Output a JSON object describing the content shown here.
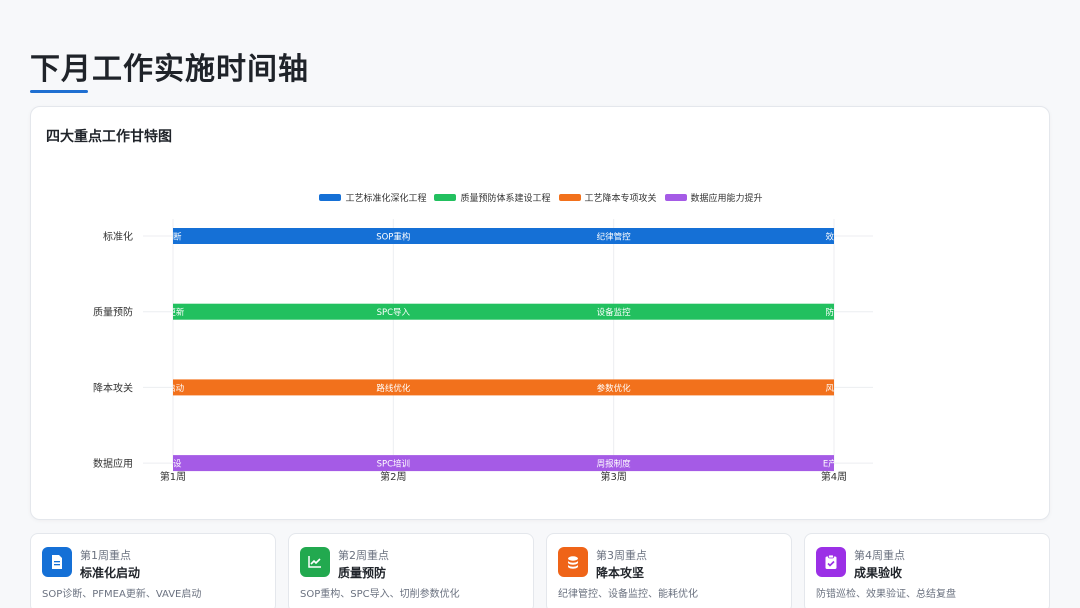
{
  "page": {
    "title": "下月工作实施时间轴"
  },
  "chart_card": {
    "title": "四大重点工作甘特图"
  },
  "colors": {
    "accent": "#1f6fd1",
    "blue": "#1570d6",
    "green": "#22c05f",
    "orange": "#f2711c",
    "purple": "#a55be6"
  },
  "chart_data": {
    "type": "bar",
    "orientation": "horizontal",
    "subtype": "gantt",
    "categories": [
      "标准化",
      "质量预防",
      "降本攻关",
      "数据应用"
    ],
    "x_ticks": [
      "第1周",
      "第2周",
      "第3周",
      "第4周"
    ],
    "xlim": [
      1,
      4
    ],
    "legend_position": "top",
    "grid": true,
    "series": [
      {
        "name": "工艺标准化深化工程",
        "color": "#1570d6",
        "category": "标准化",
        "start": 1,
        "end": 4,
        "labels": [
          {
            "x": 1,
            "text": "诊断"
          },
          {
            "x": 2,
            "text": "SOP重构"
          },
          {
            "x": 3,
            "text": "纪律管控"
          },
          {
            "x": 4,
            "text": "效果"
          }
        ]
      },
      {
        "name": "质量预防体系建设工程",
        "color": "#22c05f",
        "category": "质量预防",
        "start": 1,
        "end": 4,
        "labels": [
          {
            "x": 1,
            "text": "A更新"
          },
          {
            "x": 2,
            "text": "SPC导入"
          },
          {
            "x": 3,
            "text": "设备监控"
          },
          {
            "x": 4,
            "text": "防错"
          }
        ]
      },
      {
        "name": "工艺降本专项攻关",
        "color": "#f2711c",
        "category": "降本攻关",
        "start": 1,
        "end": 4,
        "labels": [
          {
            "x": 1,
            "text": "E启动"
          },
          {
            "x": 2,
            "text": "路线优化"
          },
          {
            "x": 3,
            "text": "参数优化"
          },
          {
            "x": 4,
            "text": "风险"
          }
        ]
      },
      {
        "name": "数据应用能力提升",
        "color": "#a55be6",
        "category": "数据应用",
        "start": 1,
        "end": 4,
        "labels": [
          {
            "x": 1,
            "text": "建设"
          },
          {
            "x": 2,
            "text": "SPC培训"
          },
          {
            "x": 3,
            "text": "周报制度"
          },
          {
            "x": 4,
            "text": "E产品"
          }
        ]
      }
    ]
  },
  "week_cards": [
    {
      "label": "第1周重点",
      "heading": "标准化启动",
      "desc": "SOP诊断、PFMEA更新、VAVE启动",
      "color": "#1570d6",
      "icon": "document-icon"
    },
    {
      "label": "第2周重点",
      "heading": "质量预防",
      "desc": "SOP重构、SPC导入、切削参数优化",
      "color": "#22a94f",
      "icon": "trend-chart-icon"
    },
    {
      "label": "第3周重点",
      "heading": "降本攻坚",
      "desc": "纪律管控、设备监控、能耗优化",
      "color": "#ef6418",
      "icon": "coins-icon"
    },
    {
      "label": "第4周重点",
      "heading": "成果验收",
      "desc": "防错巡检、效果验证、总结复盘",
      "color": "#9b30e6",
      "icon": "clipboard-check-icon"
    }
  ]
}
